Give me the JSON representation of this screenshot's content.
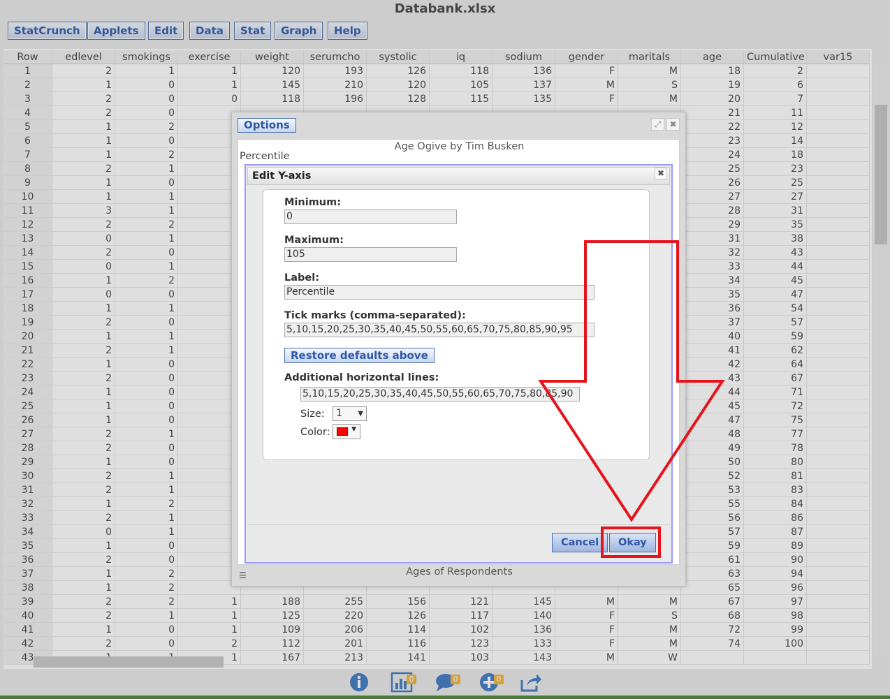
{
  "app": {
    "title": "Databank.xlsx"
  },
  "menu": [
    "StatCrunch",
    "Applets",
    "Edit",
    "Data",
    "Stat",
    "Graph",
    "Help"
  ],
  "columns": [
    "Row",
    "edlevel",
    "smokings",
    "exercise",
    "weight",
    "serumcho",
    "systolic",
    "iq",
    "sodium",
    "gender",
    "maritals",
    "age",
    "Cumulative",
    "var15"
  ],
  "rows": [
    [
      "1",
      "2",
      "1",
      "1",
      "120",
      "193",
      "126",
      "118",
      "136",
      "F",
      "M",
      "18",
      "2"
    ],
    [
      "2",
      "1",
      "0",
      "1",
      "145",
      "210",
      "120",
      "105",
      "137",
      "M",
      "S",
      "19",
      "6"
    ],
    [
      "3",
      "2",
      "0",
      "0",
      "118",
      "196",
      "128",
      "115",
      "135",
      "F",
      "M",
      "20",
      "7"
    ],
    [
      "4",
      "2",
      "0",
      "",
      "",
      "",
      "",
      "",
      "",
      "",
      "",
      "21",
      "11"
    ],
    [
      "5",
      "1",
      "2",
      "",
      "",
      "",
      "",
      "",
      "",
      "",
      "",
      "22",
      "12"
    ],
    [
      "6",
      "1",
      "0",
      "",
      "",
      "",
      "",
      "",
      "",
      "",
      "",
      "23",
      "14"
    ],
    [
      "7",
      "1",
      "2",
      "",
      "",
      "",
      "",
      "",
      "",
      "",
      "",
      "24",
      "18"
    ],
    [
      "8",
      "2",
      "1",
      "",
      "",
      "",
      "",
      "",
      "",
      "",
      "",
      "25",
      "23"
    ],
    [
      "9",
      "1",
      "0",
      "",
      "",
      "",
      "",
      "",
      "",
      "",
      "",
      "26",
      "25"
    ],
    [
      "10",
      "1",
      "1",
      "",
      "",
      "",
      "",
      "",
      "",
      "",
      "",
      "27",
      "27"
    ],
    [
      "11",
      "3",
      "1",
      "",
      "",
      "",
      "",
      "",
      "",
      "",
      "",
      "28",
      "31"
    ],
    [
      "12",
      "2",
      "2",
      "",
      "",
      "",
      "",
      "",
      "",
      "",
      "",
      "29",
      "35"
    ],
    [
      "13",
      "0",
      "1",
      "",
      "",
      "",
      "",
      "",
      "",
      "",
      "",
      "31",
      "38"
    ],
    [
      "14",
      "2",
      "0",
      "",
      "",
      "",
      "",
      "",
      "",
      "",
      "",
      "32",
      "43"
    ],
    [
      "15",
      "0",
      "1",
      "",
      "",
      "",
      "",
      "",
      "",
      "",
      "",
      "33",
      "44"
    ],
    [
      "16",
      "1",
      "2",
      "",
      "",
      "",
      "",
      "",
      "",
      "",
      "",
      "34",
      "45"
    ],
    [
      "17",
      "0",
      "0",
      "",
      "",
      "",
      "",
      "",
      "",
      "",
      "",
      "35",
      "47"
    ],
    [
      "18",
      "1",
      "1",
      "",
      "",
      "",
      "",
      "",
      "",
      "",
      "",
      "36",
      "54"
    ],
    [
      "19",
      "2",
      "0",
      "",
      "",
      "",
      "",
      "",
      "",
      "",
      "",
      "37",
      "57"
    ],
    [
      "20",
      "1",
      "1",
      "",
      "",
      "",
      "",
      "",
      "",
      "",
      "",
      "40",
      "59"
    ],
    [
      "21",
      "2",
      "1",
      "",
      "",
      "",
      "",
      "",
      "",
      "",
      "",
      "41",
      "62"
    ],
    [
      "22",
      "1",
      "0",
      "",
      "",
      "",
      "",
      "",
      "",
      "",
      "",
      "42",
      "64"
    ],
    [
      "23",
      "2",
      "0",
      "",
      "",
      "",
      "",
      "",
      "",
      "",
      "",
      "43",
      "67"
    ],
    [
      "24",
      "1",
      "0",
      "",
      "",
      "",
      "",
      "",
      "",
      "",
      "",
      "44",
      "71"
    ],
    [
      "25",
      "1",
      "0",
      "",
      "",
      "",
      "",
      "",
      "",
      "",
      "",
      "45",
      "72"
    ],
    [
      "26",
      "1",
      "0",
      "",
      "",
      "",
      "",
      "",
      "",
      "",
      "",
      "47",
      "75"
    ],
    [
      "27",
      "2",
      "1",
      "",
      "",
      "",
      "",
      "",
      "",
      "",
      "",
      "48",
      "77"
    ],
    [
      "28",
      "2",
      "0",
      "",
      "",
      "",
      "",
      "",
      "",
      "",
      "",
      "49",
      "78"
    ],
    [
      "29",
      "1",
      "0",
      "",
      "",
      "",
      "",
      "",
      "",
      "",
      "",
      "50",
      "80"
    ],
    [
      "30",
      "2",
      "1",
      "",
      "",
      "",
      "",
      "",
      "",
      "",
      "",
      "52",
      "81"
    ],
    [
      "31",
      "2",
      "1",
      "",
      "",
      "",
      "",
      "",
      "",
      "",
      "",
      "53",
      "83"
    ],
    [
      "32",
      "1",
      "2",
      "",
      "",
      "",
      "",
      "",
      "",
      "",
      "",
      "55",
      "84"
    ],
    [
      "33",
      "2",
      "1",
      "",
      "",
      "",
      "",
      "",
      "",
      "",
      "",
      "56",
      "86"
    ],
    [
      "34",
      "0",
      "1",
      "",
      "",
      "",
      "",
      "",
      "",
      "",
      "",
      "57",
      "87"
    ],
    [
      "35",
      "1",
      "0",
      "",
      "",
      "",
      "",
      "",
      "",
      "",
      "",
      "59",
      "89"
    ],
    [
      "36",
      "2",
      "0",
      "",
      "",
      "",
      "",
      "",
      "",
      "",
      "",
      "61",
      "90"
    ],
    [
      "37",
      "1",
      "2",
      "",
      "",
      "",
      "",
      "",
      "",
      "",
      "",
      "63",
      "94"
    ],
    [
      "38",
      "1",
      "2",
      "",
      "",
      "",
      "",
      "",
      "",
      "",
      "",
      "65",
      "96"
    ],
    [
      "39",
      "2",
      "2",
      "1",
      "188",
      "255",
      "156",
      "121",
      "145",
      "M",
      "M",
      "67",
      "97"
    ],
    [
      "40",
      "2",
      "1",
      "1",
      "125",
      "220",
      "126",
      "117",
      "140",
      "F",
      "S",
      "68",
      "98"
    ],
    [
      "41",
      "1",
      "0",
      "1",
      "109",
      "206",
      "114",
      "102",
      "136",
      "F",
      "M",
      "72",
      "99"
    ],
    [
      "42",
      "2",
      "0",
      "2",
      "112",
      "201",
      "116",
      "123",
      "133",
      "F",
      "M",
      "74",
      "100"
    ],
    [
      "43",
      "1",
      "1",
      "1",
      "167",
      "213",
      "141",
      "103",
      "143",
      "M",
      "W",
      "",
      ""
    ]
  ],
  "bottom_bar": {
    "badges": [
      "0",
      "0",
      "0"
    ]
  },
  "options_dialog": {
    "tab_label": "Options",
    "plot_title": "Age Ogive by Tim Busken",
    "plot_ylabel": "Percentile",
    "plot_xlabel": "Ages of Respondents",
    "edit_yaxis": {
      "title": "Edit Y-axis",
      "min_label": "Minimum:",
      "min_value": "0",
      "max_label": "Maximum:",
      "max_value": "105",
      "label_label": "Label:",
      "label_value": "Percentile",
      "ticks_label": "Tick marks (comma-separated):",
      "ticks_value": "5,10,15,20,25,30,35,40,45,50,55,60,65,70,75,80,85,90,95",
      "restore_label": "Restore defaults above",
      "hlines_label": "Additional horizontal lines:",
      "hlines_value": "5,10,15,20,25,30,35,40,45,50,55,60,65,70,75,80,85,90",
      "size_label": "Size:",
      "size_value": "1",
      "color_label": "Color:",
      "color_value": "#ff0000",
      "cancel_label": "Cancel",
      "okay_label": "Okay"
    }
  },
  "annotation_color": "#e3141c"
}
